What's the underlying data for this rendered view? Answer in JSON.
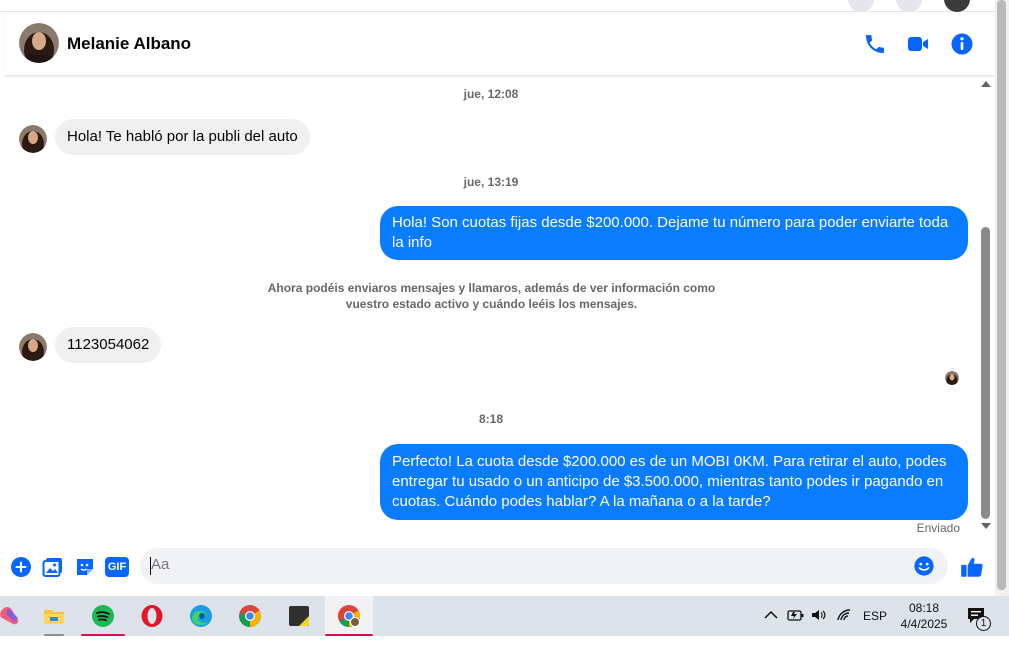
{
  "header": {
    "contact_name": "Melanie Albano",
    "icons": [
      "phone-icon",
      "video-camera-icon",
      "info-icon"
    ]
  },
  "colors": {
    "accent": "#0a7cff",
    "bubble_incoming": "#f0f0f0",
    "messenger_blue": "#0866ff"
  },
  "messages": [
    {
      "type": "time",
      "text": "jue, 12:08"
    },
    {
      "type": "incoming",
      "text": "Hola! Te habló por la publi del auto"
    },
    {
      "type": "time",
      "text": "jue, 13:19"
    },
    {
      "type": "outgoing",
      "text": "Hola! Son cuotas fijas desde $200.000. Dejame tu número para poder enviarte toda la info"
    },
    {
      "type": "notice",
      "text": "Ahora podéis enviaros mensajes y llamaros, además de ver información como vuestro estado activo y cuándo leéis los mensajes."
    },
    {
      "type": "incoming",
      "text": "1123054062"
    },
    {
      "type": "time",
      "text": "8:18"
    },
    {
      "type": "outgoing",
      "text": "Perfecto! La cuota desde $200.000 es de un MOBI 0KM. Para retirar el auto, podes entregar tu usado o un anticipo de $3.500.000, mientras tanto podes ir pagando en cuotas. Cuándo podes hablar? A la mañana o a la tarde?"
    }
  ],
  "status": {
    "sent_label": "Enviado"
  },
  "composer": {
    "placeholder": "Aa",
    "icons": [
      "plus-icon",
      "image-icon",
      "sticker-icon",
      "gif-icon",
      "emoji-icon",
      "thumbs-up-icon"
    ],
    "gif_label": "GIF"
  },
  "taskbar": {
    "apps": [
      "copilot-icon",
      "file-explorer-icon",
      "spotify-icon",
      "opera-icon",
      "edge-icon",
      "chrome-icon",
      "sticky-notes-icon",
      "chrome-profile-icon"
    ],
    "language": "ESP",
    "time": "08:18",
    "date": "4/4/2025",
    "notification_count": "1"
  }
}
